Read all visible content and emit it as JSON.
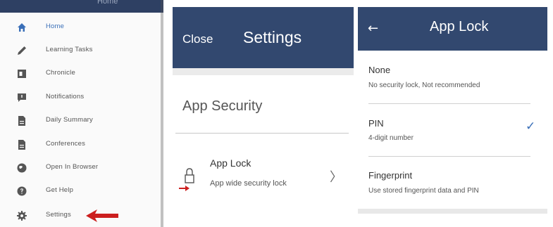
{
  "drawer": {
    "header_title": "Home",
    "items": [
      {
        "label": "Home",
        "icon": "home-icon"
      },
      {
        "label": "Learning Tasks",
        "icon": "pencil-icon"
      },
      {
        "label": "Chronicle",
        "icon": "chronicle-icon"
      },
      {
        "label": "Notifications",
        "icon": "notification-icon"
      },
      {
        "label": "Daily Summary",
        "icon": "document-icon"
      },
      {
        "label": "Conferences",
        "icon": "document-icon"
      },
      {
        "label": "Open In Browser",
        "icon": "globe-icon"
      },
      {
        "label": "Get Help",
        "icon": "help-icon"
      },
      {
        "label": "Settings",
        "icon": "gear-icon"
      }
    ],
    "active_color": "#3a6fb8"
  },
  "settings": {
    "close_label": "Close",
    "title": "Settings",
    "section": "App Security",
    "row_title": "App Lock",
    "row_subtitle": "App wide security lock",
    "row_chevron": "〉"
  },
  "app_lock": {
    "back_icon": "←",
    "title": "App Lock",
    "options": [
      {
        "title": "None",
        "subtitle": "No security lock, Not recommended",
        "selected": false
      },
      {
        "title": "PIN",
        "subtitle": "4-digit number",
        "selected": true
      },
      {
        "title": "Fingerprint",
        "subtitle": "Use stored fingerprint data and PIN",
        "selected": false
      }
    ],
    "check_mark": "✓"
  },
  "colors": {
    "header": "#32486f",
    "accent": "#3a6fb8",
    "annotation_arrow": "#cc1f1f"
  }
}
